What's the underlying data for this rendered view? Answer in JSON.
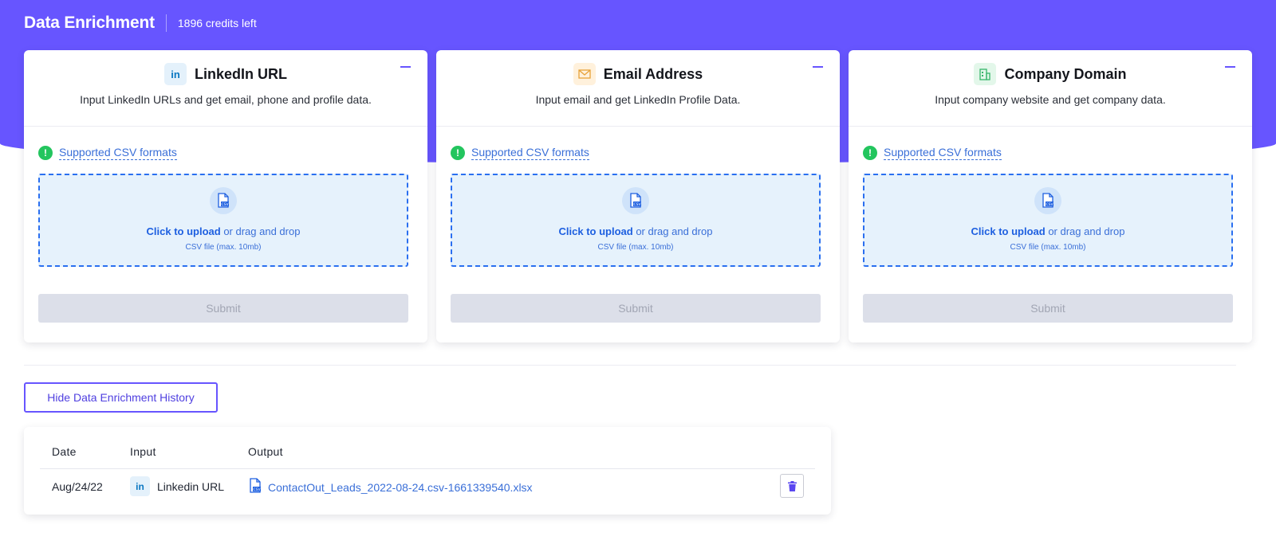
{
  "header": {
    "title": "Data Enrichment",
    "credits": "1896 credits left"
  },
  "colors": {
    "brand": "#6755ff",
    "link": "#3a6fd8",
    "success": "#23c55e"
  },
  "cards": [
    {
      "icon": "linkedin-icon",
      "title": "LinkedIn URL",
      "subtitle": "Input LinkedIn URLs and get email, phone and profile data.",
      "supported_label": "Supported CSV formats",
      "upload_action": "Click to upload",
      "upload_rest": " or drag and drop",
      "upload_hint": "CSV file (max. 10mb)",
      "submit_label": "Submit"
    },
    {
      "icon": "envelope-icon",
      "title": "Email Address",
      "subtitle": "Input email and get LinkedIn Profile Data.",
      "supported_label": "Supported CSV formats",
      "upload_action": "Click to upload",
      "upload_rest": " or drag and drop",
      "upload_hint": "CSV file (max. 10mb)",
      "submit_label": "Submit"
    },
    {
      "icon": "building-icon",
      "title": "Company Domain",
      "subtitle": "Input company website and get company data.",
      "supported_label": "Supported CSV formats",
      "upload_action": "Click to upload",
      "upload_rest": " or drag and drop",
      "upload_hint": "CSV file (max. 10mb)",
      "submit_label": "Submit"
    }
  ],
  "history": {
    "toggle_label": "Hide Data Enrichment History",
    "columns": [
      "Date",
      "Input",
      "Output"
    ],
    "rows": [
      {
        "date": "Aug/24/22",
        "input": "Linkedin URL",
        "output": "ContactOut_Leads_2022-08-24.csv-1661339540.xlsx"
      }
    ]
  }
}
